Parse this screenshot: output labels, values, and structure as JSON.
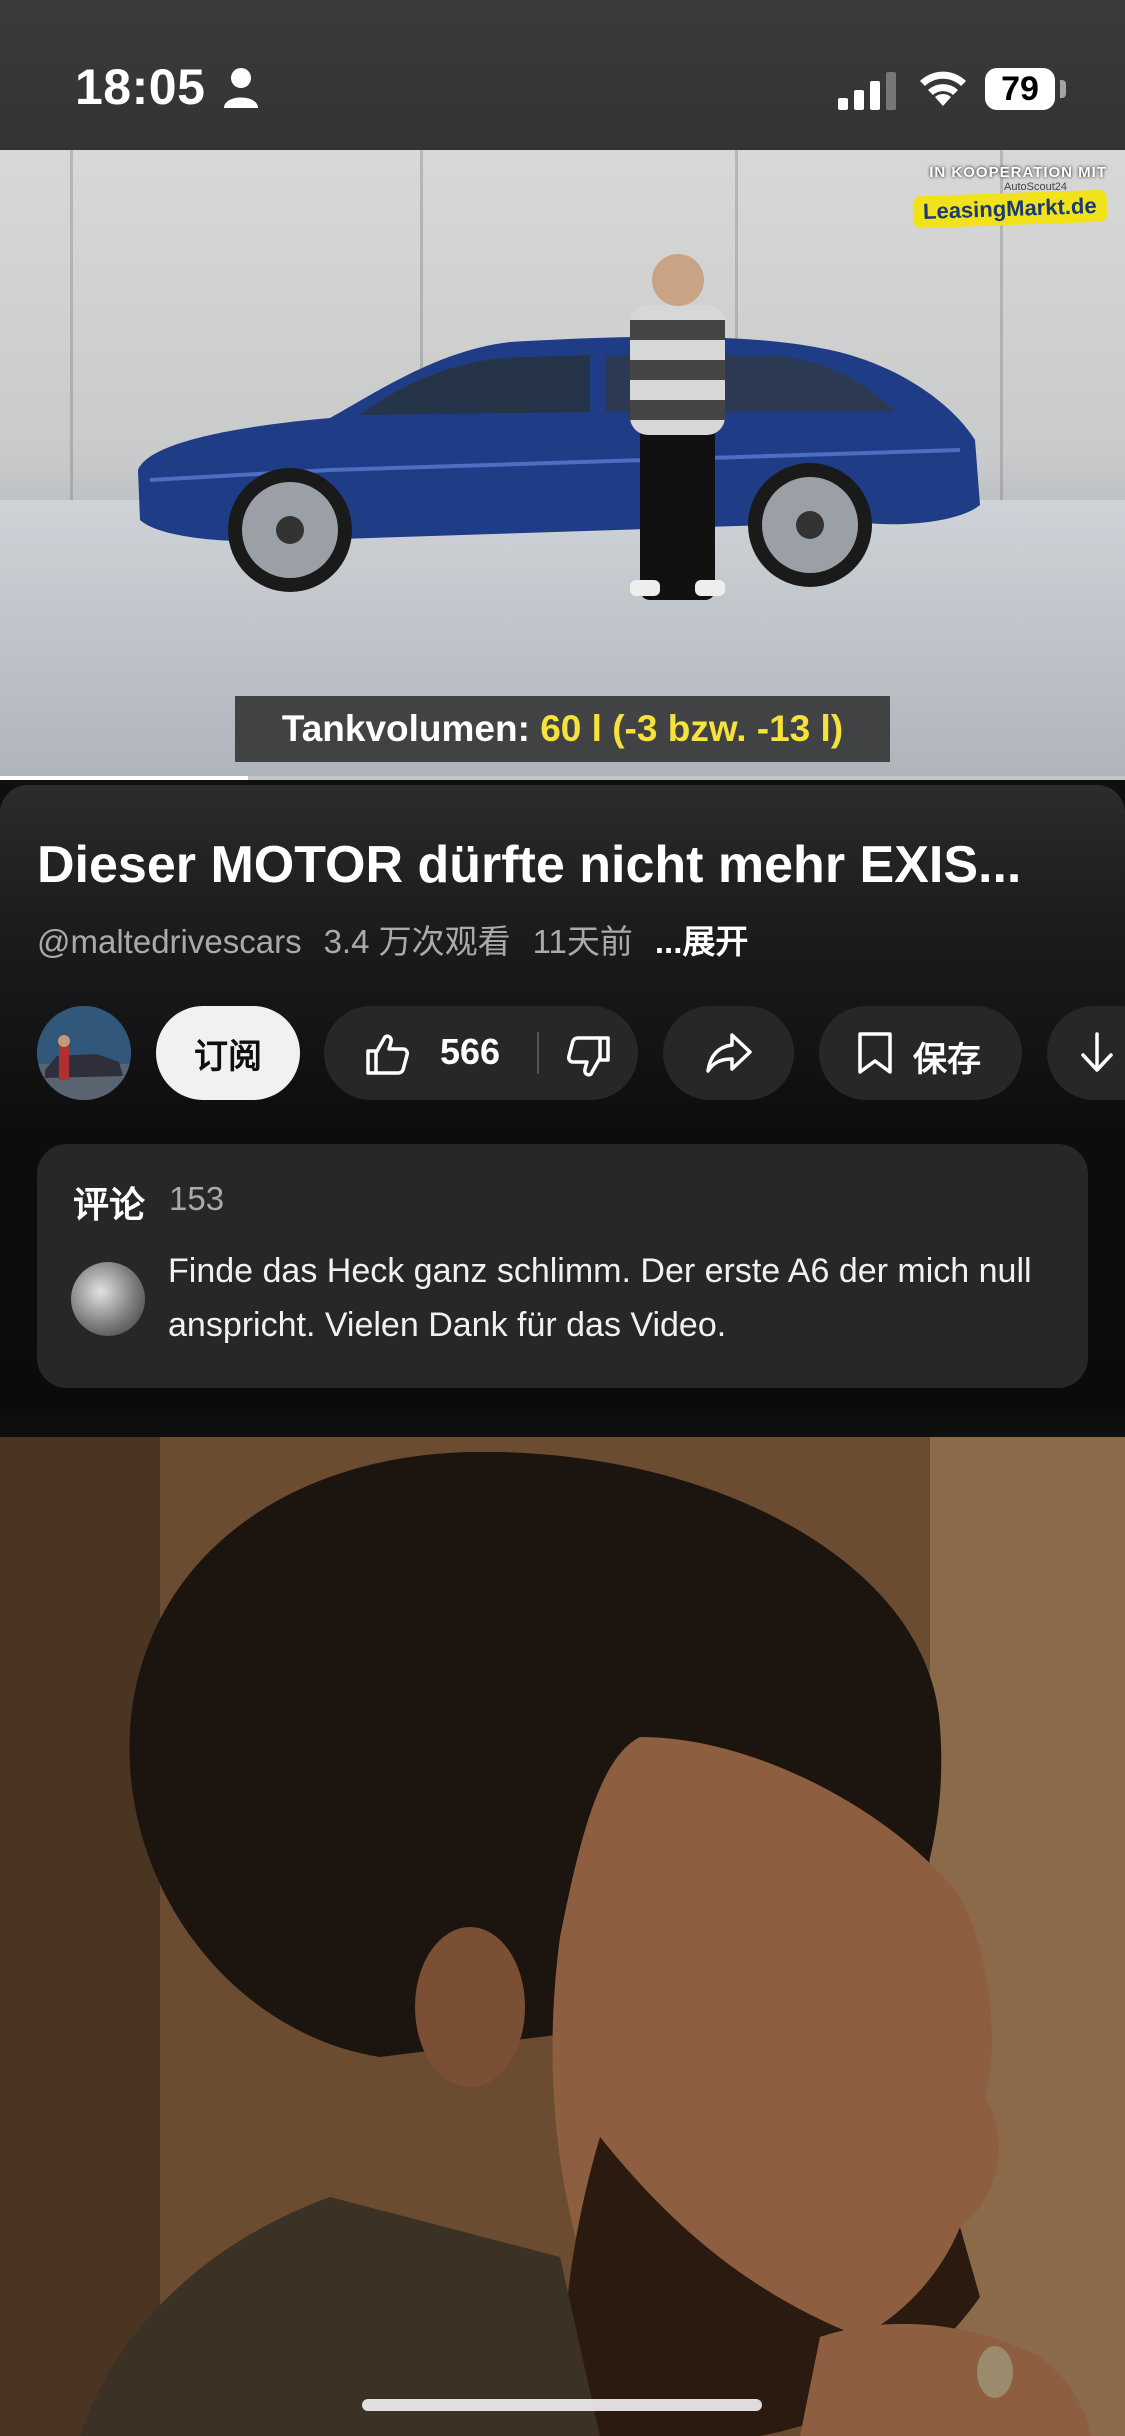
{
  "status_bar": {
    "time": "18:05",
    "battery": "79"
  },
  "video": {
    "coop_line1": "IN KOOPERATION MIT",
    "coop_line2": "AutoScout24",
    "coop_line3": "LeasingMarkt.de",
    "caption_prefix": "Tankvolumen: ",
    "caption_highlight": "60 l (-3 bzw. -13 l)",
    "progress": 0.22
  },
  "details": {
    "title": "Dieser MOTOR dürfte nicht mehr EXIS...",
    "channel": "@maltedrivescars",
    "views": "3.4 万次观看",
    "age": "11天前",
    "more": "...展开"
  },
  "actions": {
    "subscribe": "订阅",
    "likes": "566",
    "save": "保存"
  },
  "comments": {
    "heading": "评论",
    "count": "153",
    "top_comment": "Finde das Heck ganz schlimm. Der erste A6 der mich null anspricht. Vielen Dank für das Video."
  },
  "icons": [
    "person-icon",
    "signal-icon",
    "wifi-icon",
    "like-icon",
    "dislike-icon",
    "share-icon",
    "bookmark-icon",
    "download-icon"
  ]
}
